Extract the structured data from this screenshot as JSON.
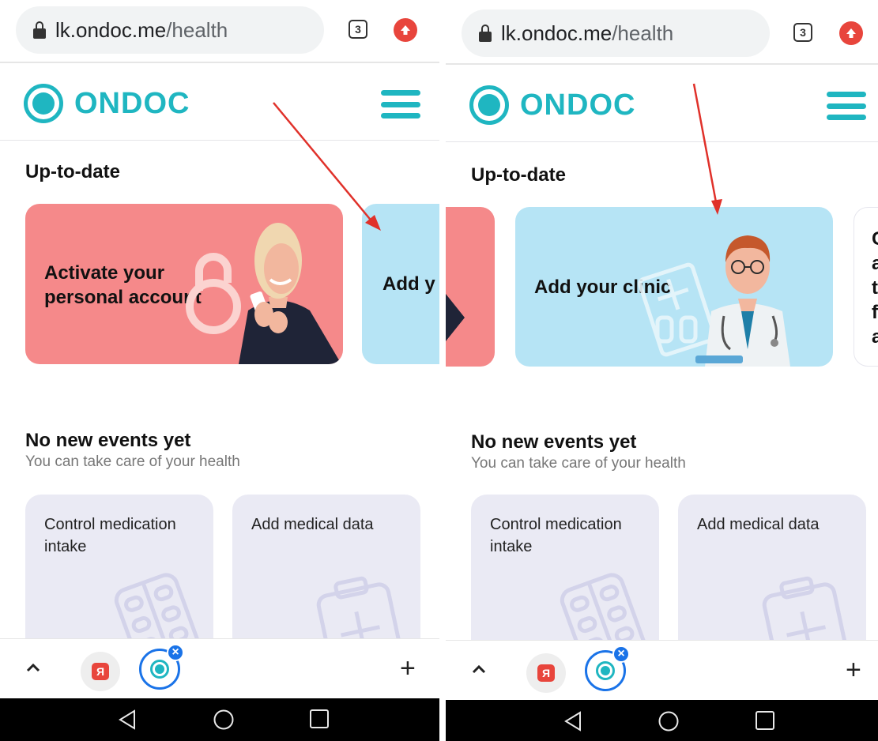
{
  "screens": [
    {
      "browser": {
        "url_host": "lk.ondoc.me",
        "url_path": "/health",
        "tabs_count": "3"
      },
      "site": {
        "logo_text": "ONDOC"
      },
      "up_to_date": {
        "title": "Up-to-date",
        "cards": [
          {
            "label_line1": "Activate your",
            "label_line2": "personal account"
          },
          {
            "label_line1": "Add y"
          }
        ]
      },
      "events": {
        "title": "No new events yet",
        "subtitle": "You can take care of your health"
      },
      "actions": [
        {
          "label_line1": "Control medication",
          "label_line2": "intake"
        },
        {
          "label_line1": "Add medical data",
          "label_line2": ""
        }
      ],
      "toolbar": {
        "yandex_glyph": "Я",
        "close_glyph": "×",
        "plus_glyph": "+"
      }
    },
    {
      "browser": {
        "url_host": "lk.ondoc.me",
        "url_path": "/health",
        "tabs_count": "3"
      },
      "site": {
        "logo_text": "ONDOC"
      },
      "up_to_date": {
        "title": "Up-to-date",
        "cards": [
          {
            "label_line1": "Add your clinic"
          },
          {
            "label_lines": [
              "C",
              "a",
              "t",
              "f",
              "a"
            ]
          }
        ]
      },
      "events": {
        "title": "No new events yet",
        "subtitle": "You can take care of your health"
      },
      "actions": [
        {
          "label_line1": "Control medication",
          "label_line2": "intake"
        },
        {
          "label_line1": "Add medical data",
          "label_line2": ""
        }
      ],
      "toolbar": {
        "yandex_glyph": "Я",
        "close_glyph": "×",
        "plus_glyph": "+"
      }
    }
  ],
  "colors": {
    "brand": "#1fb6c1",
    "card_pink": "#f5898a",
    "card_blue": "#b6e4f5",
    "action_card": "#eaeaf4",
    "annotation_arrow": "#e0312a",
    "tab_accent": "#1a73e8"
  },
  "icons": [
    "lock-icon",
    "tabs-count-icon",
    "update-icon",
    "menu-icon",
    "chevron-up-icon",
    "yandex-tab-icon",
    "ondoc-tab-icon",
    "close-icon",
    "plus-icon",
    "back-icon",
    "home-icon",
    "recents-icon"
  ]
}
